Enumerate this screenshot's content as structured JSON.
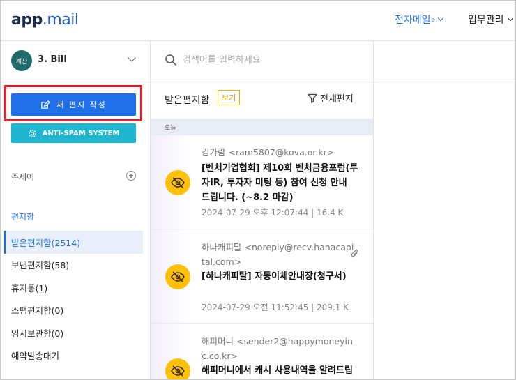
{
  "header": {
    "logo_part1": "app",
    "logo_part2": ".mail",
    "nav_mail": "전자메일",
    "nav_mail_sup": "a",
    "nav_work": "업무관리"
  },
  "account": {
    "avatar_text": "계산",
    "name": "3. Bill"
  },
  "sidebar": {
    "compose_label": "새 편지 작성",
    "spam_label": "ANTI-SPAM SYSTEM",
    "subject_label": "주제어",
    "folder_header": "편지함",
    "folders": [
      {
        "label": "받은편지함(2514)"
      },
      {
        "label": "보낸편지함(58)"
      },
      {
        "label": "휴지통(1)"
      },
      {
        "label": "스팸편지함(0)"
      },
      {
        "label": "임시보관함(0)"
      },
      {
        "label": "예약발송대기"
      }
    ]
  },
  "search": {
    "placeholder": "검색어를 입력하세요"
  },
  "list": {
    "title": "받은편지함",
    "view_badge": "보기",
    "filter_label": "전체편지",
    "section_today": "오늘",
    "mails": [
      {
        "from": "김가람 <ram5807@kova.or.kr>",
        "subject": "[벤처기업협회] 제10회 벤처금융포럼(투자IR, 투자자 미팅 등) 참여 신청 안내 드립니다. (~8.2 마감)",
        "meta": "2024-07-29 오후 12:07:44 | 16.4 K"
      },
      {
        "from": "하나캐피탈 <noreply@recv.hanacapital.com>",
        "subject": "[하나캐피탈] 자동이체안내장(청구서)",
        "meta": "2024-07-29 오전 11:52:45 | 209.1 K"
      },
      {
        "from": "해피머니 <sender2@happymoneyinc.co.kr>",
        "subject": "해피머니에서 캐시 사용내역을 알려드립니다.",
        "meta": ""
      }
    ]
  },
  "colors": {
    "accent": "#1f6fe8",
    "spam": "#1fb7d0",
    "highlight_box": "#e8202a",
    "mail_icon": "#ffc107"
  }
}
